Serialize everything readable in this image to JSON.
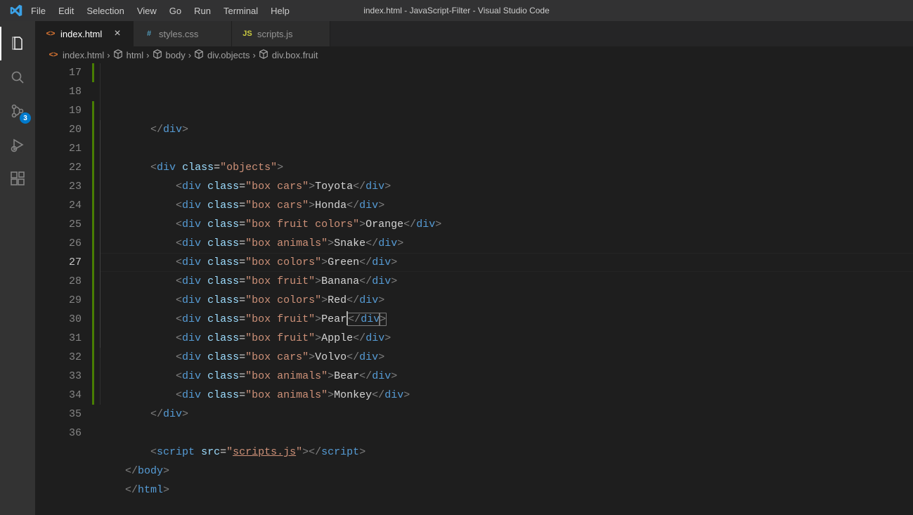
{
  "window_title": "index.html - JavaScript-Filter - Visual Studio Code",
  "menu": [
    "File",
    "Edit",
    "Selection",
    "View",
    "Go",
    "Run",
    "Terminal",
    "Help"
  ],
  "activity": {
    "scm_badge": "3"
  },
  "tabs": [
    {
      "label": "index.html",
      "icon": "html",
      "active": true
    },
    {
      "label": "styles.css",
      "icon": "css",
      "active": false
    },
    {
      "label": "scripts.js",
      "icon": "js",
      "active": false
    }
  ],
  "breadcrumbs": [
    {
      "kind": "file",
      "icon": "html",
      "label": "index.html"
    },
    {
      "kind": "symbol",
      "label": "html"
    },
    {
      "kind": "symbol",
      "label": "body"
    },
    {
      "kind": "symbol",
      "label": "div.objects"
    },
    {
      "kind": "symbol",
      "label": "div.box.fruit"
    }
  ],
  "editor": {
    "first_line_no": 17,
    "active_line_index": 10,
    "lines": [
      {
        "indent": 8,
        "kind": "close",
        "tag": "div"
      },
      {
        "indent": 0,
        "kind": "blank"
      },
      {
        "indent": 8,
        "kind": "open",
        "tag": "div",
        "attrs": [
          [
            "class",
            "objects"
          ]
        ]
      },
      {
        "indent": 12,
        "kind": "full",
        "tag": "div",
        "attrs": [
          [
            "class",
            "box cars"
          ]
        ],
        "text": "Toyota"
      },
      {
        "indent": 12,
        "kind": "full",
        "tag": "div",
        "attrs": [
          [
            "class",
            "box cars"
          ]
        ],
        "text": "Honda"
      },
      {
        "indent": 12,
        "kind": "full",
        "tag": "div",
        "attrs": [
          [
            "class",
            "box fruit colors"
          ]
        ],
        "text": "Orange"
      },
      {
        "indent": 12,
        "kind": "full",
        "tag": "div",
        "attrs": [
          [
            "class",
            "box animals"
          ]
        ],
        "text": "Snake"
      },
      {
        "indent": 12,
        "kind": "full",
        "tag": "div",
        "attrs": [
          [
            "class",
            "box colors"
          ]
        ],
        "text": "Green"
      },
      {
        "indent": 12,
        "kind": "full",
        "tag": "div",
        "attrs": [
          [
            "class",
            "box fruit"
          ]
        ],
        "text": "Banana"
      },
      {
        "indent": 12,
        "kind": "full",
        "tag": "div",
        "attrs": [
          [
            "class",
            "box colors"
          ]
        ],
        "text": "Red"
      },
      {
        "indent": 12,
        "kind": "full",
        "tag": "div",
        "attrs": [
          [
            "class",
            "box fruit"
          ]
        ],
        "text": "Pear",
        "cursor_after_text": true,
        "match_close": true
      },
      {
        "indent": 12,
        "kind": "full",
        "tag": "div",
        "attrs": [
          [
            "class",
            "box fruit"
          ]
        ],
        "text": "Apple"
      },
      {
        "indent": 12,
        "kind": "full",
        "tag": "div",
        "attrs": [
          [
            "class",
            "box cars"
          ]
        ],
        "text": "Volvo"
      },
      {
        "indent": 12,
        "kind": "full",
        "tag": "div",
        "attrs": [
          [
            "class",
            "box animals"
          ]
        ],
        "text": "Bear"
      },
      {
        "indent": 12,
        "kind": "full",
        "tag": "div",
        "attrs": [
          [
            "class",
            "box animals"
          ]
        ],
        "text": "Monkey"
      },
      {
        "indent": 8,
        "kind": "close",
        "tag": "div"
      },
      {
        "indent": 0,
        "kind": "blank"
      },
      {
        "indent": 8,
        "kind": "script",
        "src": "scripts.js"
      },
      {
        "indent": 4,
        "kind": "close",
        "tag": "body"
      },
      {
        "indent": 4,
        "kind": "close",
        "tag": "html"
      }
    ],
    "gutter_mods": [
      {
        "start": 0,
        "end": 1,
        "type": "green"
      },
      {
        "start": 2,
        "end": 18,
        "type": "green"
      }
    ]
  }
}
